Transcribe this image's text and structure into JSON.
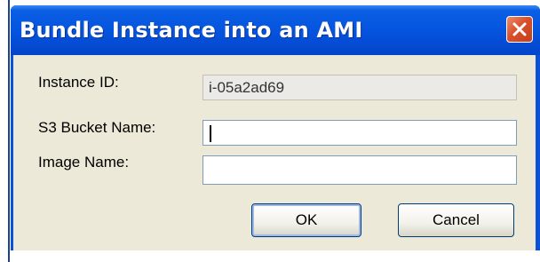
{
  "dialog": {
    "title": "Bundle Instance into an AMI",
    "close_icon": "close-icon"
  },
  "form": {
    "instance_id_label": "Instance ID:",
    "instance_id_value": "i-05a2ad69",
    "s3_bucket_label": "S3 Bucket Name:",
    "s3_bucket_value": "",
    "image_name_label": "Image Name:",
    "image_name_value": ""
  },
  "buttons": {
    "ok_label": "OK",
    "cancel_label": "Cancel"
  },
  "colors": {
    "titlebar": "#0553de",
    "close_button": "#d9512c",
    "client_background": "#ece9d8"
  }
}
